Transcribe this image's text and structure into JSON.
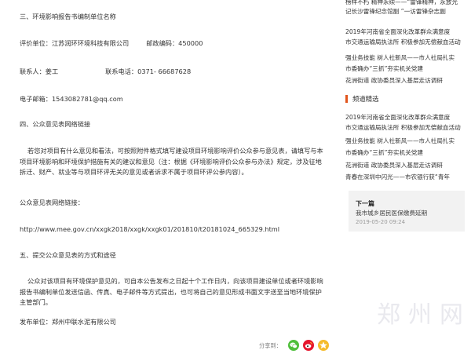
{
  "article": {
    "sec3_title": "三、环境影响报告书编制单位名称",
    "evaluator_label": "评价单位：",
    "evaluator_value": "江苏润环环境科技有限公司",
    "postcode_label": "邮政编码：",
    "postcode_value": "450000",
    "contact_label": "联系人：",
    "contact_value": "姜工",
    "phone_label": "联系电话：",
    "phone_value": "0371- 66687628",
    "email_label": "电子邮箱：",
    "email_value": "1543082781@qq.com",
    "sec4_title": "四、公众意见表网络链接",
    "sec4_para": "若您对项目有什么意见和看法，可按照附件格式填写建设项目环境影响评价公众参与意见表，请填写与本项目环境影响和环境保护措施有关的建议和意见（注：根据《环境影响评价公众参与办法》规定，涉及征地拆迁、财产、就业等与项目环评无关的意见或者诉求不属于项目环评公参内容）。",
    "link_label": "公众意见表网络链接：",
    "link_url": "http://www.mee.gov.cn/xxgk2018/xxgk/xxgk01/201810/t20181024_665329.html",
    "sec5_title": "五、提交公众意见表的方式和途径",
    "sec5_para": "公众对该项目有环境保护意见的，可自本公告发布之日起十个工作日内，向该项目建设单位或者环境影响报告书编制单位发送信函、传真、电子邮件等方式提出，也可将自己的意见形成书面文字送至当地环境保护主管部门。",
    "publisher_label": "发布单位：",
    "publisher_value": "郑州中联水泥有限公司"
  },
  "sidebar": {
    "top_items": [
      "榜样不朽 精神永续——“雷锋精神，永放光",
      "记长沙雷锋纪念馆副    ”一访雷锋杂志副",
      "2019年河南省全面深化改革群众满意度",
      "市交通运输局执法所 积极参加无偿献血活动",
      "强业务技能 树人社新风——市人社局扎实",
      "市委确办“三抓”夯实机关党建",
      "花洲街道 政协委员深入基层走访调研"
    ],
    "section_title": "频道精选",
    "featured_items": [
      "2019年河南省全面深化改革群众满意度",
      "市交通运输局执法所 积极参加无偿献血活动",
      "强业务技能 树人社新风——市人社局扎实",
      "市委确办“三抓”夯实机关党建",
      "花洲街道 政协委员深入基层走访调研",
      "青春在深圳中闪光——市农银行获“青年"
    ],
    "next": {
      "title": "下一篇",
      "link": "我市城乡居民医保缴费延期",
      "date": "2019-05-20 09:24"
    }
  },
  "watermark": "郑州网",
  "share": {
    "label": "分享到：",
    "icons": [
      "wechat-icon",
      "weibo-icon",
      "qzone-icon"
    ]
  },
  "colors": {
    "accent": "#e1551d",
    "wechat": "#4fbf3b",
    "weibo": "#e6162d",
    "qzone": "#f5bb2a",
    "next_box_bg": "#f2f2f2"
  }
}
